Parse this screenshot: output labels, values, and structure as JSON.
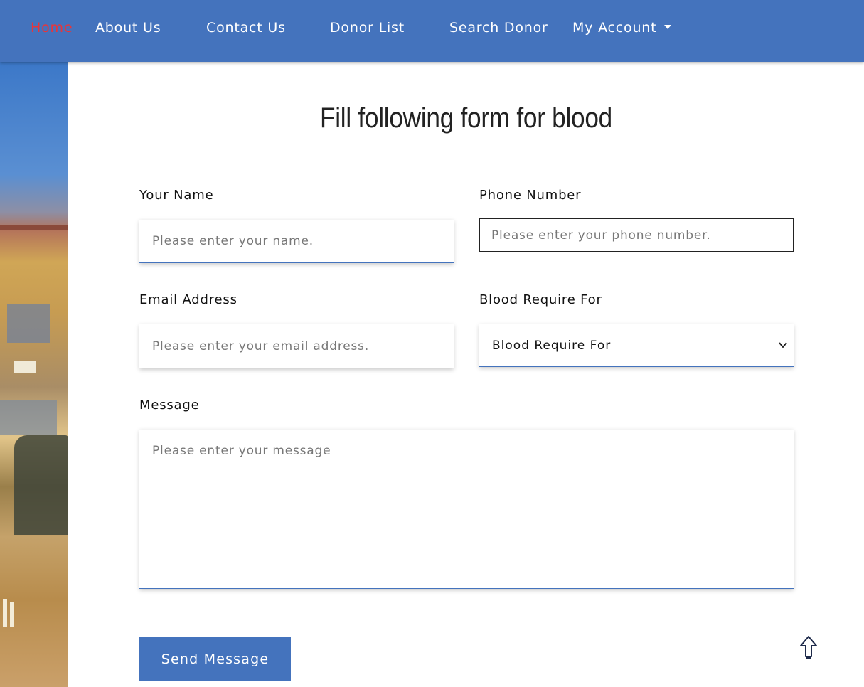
{
  "nav": {
    "items": [
      {
        "label": "Home",
        "active": true
      },
      {
        "label": "About Us"
      },
      {
        "label": "Contact Us"
      },
      {
        "label": "Donor List"
      },
      {
        "label": "Search Donor"
      },
      {
        "label": "My Account",
        "icon": "caret-down-icon"
      }
    ]
  },
  "form": {
    "title": "Fill following form for blood",
    "name": {
      "label": "Your Name",
      "placeholder": "Please enter your name."
    },
    "phone": {
      "label": "Phone Number",
      "placeholder": "Please enter your phone number."
    },
    "email": {
      "label": "Email Address",
      "placeholder": "Please enter your email address."
    },
    "blood_for": {
      "label": "Blood Require For",
      "selected": "Blood Require For",
      "icon": "chevron-down-icon"
    },
    "message": {
      "label": "Message",
      "placeholder": "Please enter your message"
    },
    "submit_label": "Send Message"
  },
  "scroll_top": {
    "icon": "arrow-up-icon"
  },
  "colors": {
    "navbar": "#4473bd",
    "active_nav": "#e8353a",
    "button": "#4473bd",
    "text": "#111111"
  }
}
